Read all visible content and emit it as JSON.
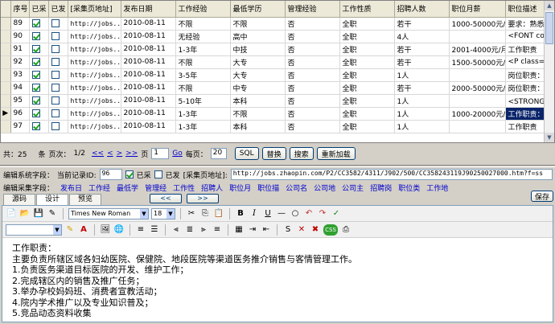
{
  "grid": {
    "columns": [
      "序号",
      "已采",
      "已发",
      "[采集页地址]",
      "发布日期",
      "工作经验",
      "最低学历",
      "管理经验",
      "工作性质",
      "招聘人数",
      "职位月薪",
      "职位描述"
    ],
    "rows": [
      {
        "no": "89",
        "collected": true,
        "published": false,
        "url": "http://jobs....",
        "date": "2010-08-11",
        "exp": "不限",
        "edu": "不限",
        "mgmt": "否",
        "nature": "全职",
        "count": "若干",
        "salary": "1000-50000元/月",
        "desc": "要求：熟悉",
        "current": false,
        "desc_selected": false
      },
      {
        "no": "90",
        "collected": true,
        "published": false,
        "url": "http://jobs....",
        "date": "2010-08-11",
        "exp": "无经验",
        "edu": "高中",
        "mgmt": "否",
        "nature": "全职",
        "count": "4人",
        "salary": "",
        "desc": "<FONT col",
        "current": false,
        "desc_selected": false
      },
      {
        "no": "91",
        "collected": true,
        "published": false,
        "url": "http://jobs....",
        "date": "2010-08-11",
        "exp": "1-3年",
        "edu": "中技",
        "mgmt": "否",
        "nature": "全职",
        "count": "若干",
        "salary": "2001-4000元/月",
        "desc": "工作职责",
        "current": false,
        "desc_selected": false
      },
      {
        "no": "92",
        "collected": true,
        "published": false,
        "url": "http://jobs....",
        "date": "2010-08-11",
        "exp": "不限",
        "edu": "大专",
        "mgmt": "否",
        "nature": "全职",
        "count": "若干",
        "salary": "1500-50000元/月",
        "desc": "<P class=",
        "current": false,
        "desc_selected": false
      },
      {
        "no": "93",
        "collected": true,
        "published": false,
        "url": "http://jobs....",
        "date": "2010-08-11",
        "exp": "3-5年",
        "edu": "大专",
        "mgmt": "否",
        "nature": "全职",
        "count": "1人",
        "salary": "",
        "desc": "岗位职责：",
        "current": false,
        "desc_selected": false
      },
      {
        "no": "94",
        "collected": true,
        "published": false,
        "url": "http://jobs....",
        "date": "2010-08-11",
        "exp": "不限",
        "edu": "中专",
        "mgmt": "否",
        "nature": "全职",
        "count": "若干",
        "salary": "2000-50000元/月",
        "desc": "岗位职责：",
        "current": false,
        "desc_selected": false
      },
      {
        "no": "95",
        "collected": true,
        "published": false,
        "url": "http://jobs....",
        "date": "2010-08-11",
        "exp": "5-10年",
        "edu": "本科",
        "mgmt": "否",
        "nature": "全职",
        "count": "1人",
        "salary": "",
        "desc": "<STRONG>岗",
        "current": false,
        "desc_selected": false
      },
      {
        "no": "96",
        "collected": true,
        "published": false,
        "url": "http://jobs....",
        "date": "2010-08-11",
        "exp": "1-3年",
        "edu": "不限",
        "mgmt": "否",
        "nature": "全职",
        "count": "1人",
        "salary": "1000-20000元/月",
        "desc": "工作职责：",
        "current": true,
        "desc_selected": true
      },
      {
        "no": "97",
        "collected": true,
        "published": false,
        "url": "http://jobs....",
        "date": "2010-08-11",
        "exp": "1-3年",
        "edu": "本科",
        "mgmt": "否",
        "nature": "全职",
        "count": "1人",
        "salary": "",
        "desc": "工作职责",
        "current": false,
        "desc_selected": false
      }
    ]
  },
  "pager": {
    "total_label": "共：25",
    "items_label": "条",
    "page_label": "页次：",
    "page_value": "1/2",
    "first": "<<",
    "prev": "<",
    "next": ">",
    "last": ">>",
    "goto_label": "页",
    "goto_value": "1",
    "go": "Go",
    "per_page_label": "每页：",
    "per_page_value": "20",
    "sql": "SQL",
    "replace": "替换",
    "search": "搜索",
    "reload": "重新加载"
  },
  "edit": {
    "field_label": "编辑系统字段：",
    "record_label": "当前记录ID:",
    "record_id": "96",
    "collected_label": "已采",
    "published_label": "已发",
    "url_label": "[采集页地址]:",
    "url_value": "http://jobs.zhaopin.com/P2/CC3582/4311/J902/500/CC358243119J90250027000.htm?f=ss",
    "collect_field_label": "编辑采集字段：",
    "fields": [
      "发布日",
      "工作经",
      "最低学",
      "管理经",
      "工作性",
      "招聘人",
      "职位月",
      "职位描",
      "公司名",
      "公司地",
      "公司主",
      "招聘岗",
      "职位类",
      "工作地"
    ],
    "save": "保存"
  },
  "tabs": [
    "源码",
    "设计",
    "预览"
  ],
  "nav_buttons": [
    "<<",
    ">>",
    "<<",
    ">>"
  ],
  "editor": {
    "font_name": "Times New Roman",
    "font_size": "18",
    "content": [
      "工作职责：",
      "主要负责所辖区域各妇幼医院、保健院、地段医院等渠道医务推介销售与客情管理工作。",
      "1.负责医务渠道目标医院的开发、维护工作；",
      "2.完成辖区内的销售及推广任务；",
      "3.举办孕校妈妈班、消费者宣教活动；",
      "4.院内学术推广以及专业知识普及；",
      "5.竞品动态资料收集"
    ]
  }
}
